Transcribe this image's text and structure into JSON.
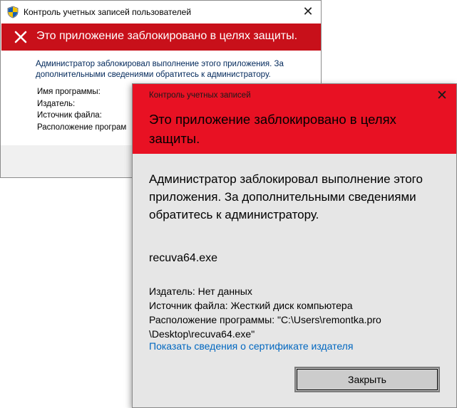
{
  "back_dialog": {
    "title": "Контроль учетных записей пользователей",
    "close_glyph": "✕",
    "banner_text": "Это приложение заблокировано в целях защиты.",
    "description": "Администратор заблокировал выполнение этого приложения. За дополнительными сведениями обратитесь к администратору.",
    "fields": {
      "program_name": "Имя программы:",
      "publisher": "Издатель:",
      "file_source": "Источник файла:",
      "location": "Расположение програм"
    },
    "icons": {
      "title": "uac-shield-icon",
      "error": "error-x-icon"
    }
  },
  "front_dialog": {
    "title": "Контроль учетных записей",
    "close_glyph": "✕",
    "header_text": "Это приложение заблокировано в целях защиты.",
    "message": "Администратор заблокировал выполнение этого приложения. За дополнительными сведениями обратитесь к администратору.",
    "program": "recuva64.exe",
    "publisher": "Издатель: Нет данных",
    "file_source": "Источник файла: Жесткий диск компьютера",
    "location_line1": "Расположение программы: \"C:\\Users\\remontka.pro",
    "location_line2": "\\Desktop\\recuva64.exe\"",
    "cert_link": "Показать сведения о сертификате издателя",
    "close_button": "Закрыть"
  },
  "colors": {
    "back_banner": "#c8101a",
    "front_header": "#e81123",
    "front_body": "#e6e6e6",
    "link": "#0067c0"
  }
}
